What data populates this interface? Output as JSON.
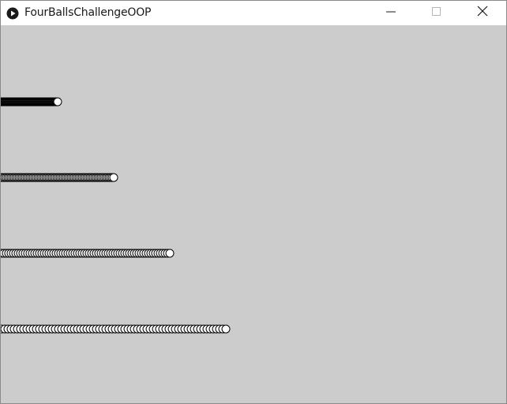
{
  "window": {
    "title": "FourBallsChallengeOOP"
  },
  "icons": {
    "app": "processing-play-icon",
    "minimize": "minimize-icon",
    "maximize": "maximize-icon",
    "close": "close-icon"
  },
  "colors": {
    "background": "#cccccc",
    "ball_fill": "#ffffff",
    "ball_stroke": "#000000",
    "titlebar": "#ffffff"
  },
  "sketch": {
    "balls": [
      {
        "name": "ball-1",
        "trail_spacing": 1,
        "trail_count": 72
      },
      {
        "name": "ball-2",
        "trail_spacing": 2,
        "trail_count": 72
      },
      {
        "name": "ball-3",
        "trail_spacing": 3,
        "trail_count": 72
      },
      {
        "name": "ball-4",
        "trail_spacing": 4,
        "trail_count": 72
      }
    ]
  }
}
